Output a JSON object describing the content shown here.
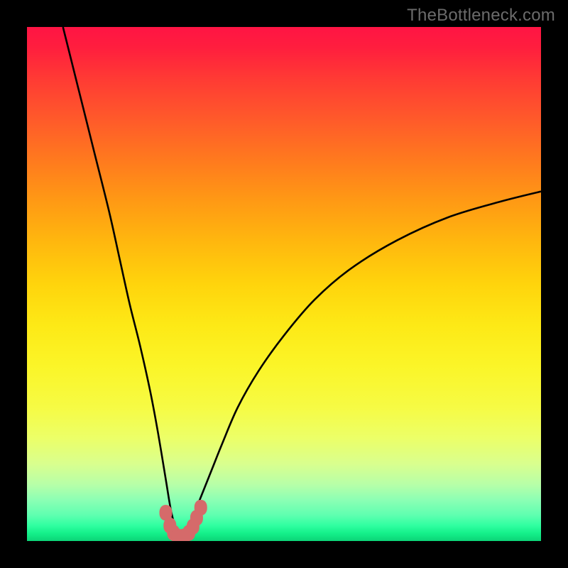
{
  "watermark": "TheBottleneck.com",
  "chart_data": {
    "type": "line",
    "title": "",
    "xlabel": "",
    "ylabel": "",
    "xlim": [
      0,
      100
    ],
    "ylim": [
      0,
      100
    ],
    "grid": false,
    "legend": false,
    "series": [
      {
        "name": "bottleneck-curve",
        "x": [
          7,
          10,
          13,
          16,
          18,
          20,
          22,
          24,
          25.5,
          27,
          28,
          29,
          29.5,
          30,
          31,
          32,
          33,
          34,
          36,
          38,
          41,
          45,
          50,
          56,
          63,
          72,
          82,
          92,
          100
        ],
        "y": [
          100,
          88,
          76,
          64,
          55,
          46,
          38,
          29,
          21,
          12,
          6,
          2,
          0.5,
          1,
          2,
          4,
          6.5,
          9,
          14,
          19,
          26,
          33,
          40,
          47,
          53,
          58.5,
          63,
          66,
          68
        ]
      },
      {
        "name": "marker-cluster",
        "x": [
          27,
          27.8,
          28.5,
          29.3,
          30,
          30.6,
          31.5,
          32.3,
          33,
          33.8
        ],
        "y": [
          5.5,
          3.0,
          1.6,
          0.9,
          0.7,
          0.9,
          1.6,
          2.8,
          4.5,
          6.5
        ]
      }
    ],
    "gradient_colors": {
      "top": "#ff1444",
      "mid": "#ffd40c",
      "bottom": "#0cd477"
    },
    "marker_color": "#d56a6a",
    "curve_color": "#000000"
  }
}
